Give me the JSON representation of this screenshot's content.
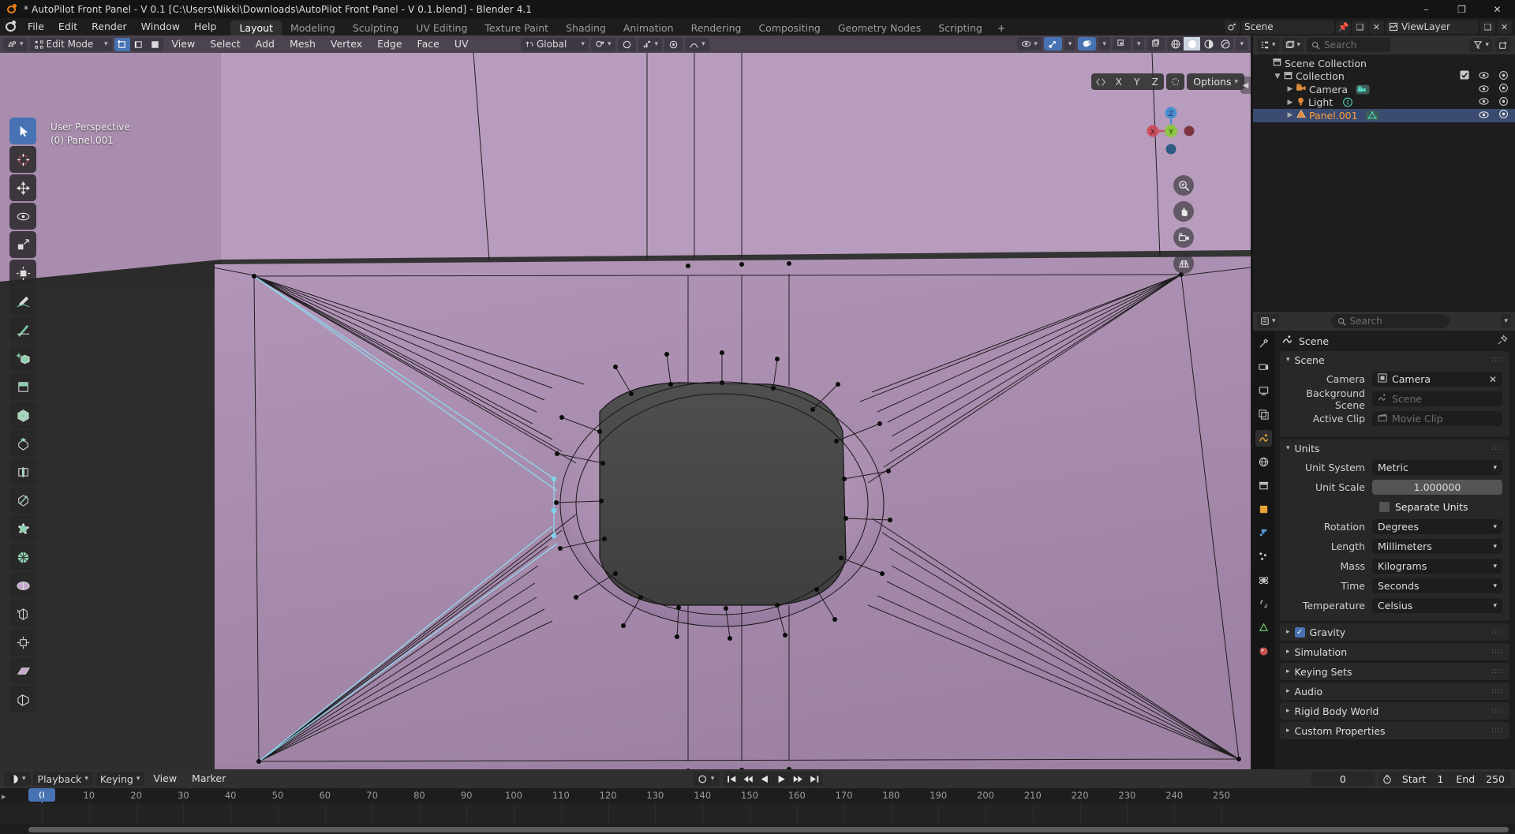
{
  "window": {
    "title": "* AutoPilot Front Panel - V 0.1 [C:\\Users\\Nikki\\Downloads\\AutoPilot Front Panel - V 0.1.blend] - Blender 4.1",
    "minimize": "–",
    "maximize": "❐",
    "close": "✕",
    "logo_icon": "blender-logo-icon"
  },
  "topbar": {
    "logo_icon": "blender-menu-icon",
    "menus": [
      "File",
      "Edit",
      "Render",
      "Window",
      "Help"
    ],
    "workspaces": [
      {
        "label": "Layout",
        "active": true
      },
      {
        "label": "Modeling",
        "active": false
      },
      {
        "label": "Sculpting",
        "active": false
      },
      {
        "label": "UV Editing",
        "active": false
      },
      {
        "label": "Texture Paint",
        "active": false
      },
      {
        "label": "Shading",
        "active": false
      },
      {
        "label": "Animation",
        "active": false
      },
      {
        "label": "Rendering",
        "active": false
      },
      {
        "label": "Compositing",
        "active": false
      },
      {
        "label": "Geometry Nodes",
        "active": false
      },
      {
        "label": "Scripting",
        "active": false
      }
    ],
    "add_workspace": "+",
    "scene_name": "Scene",
    "view_layer_name": "ViewLayer"
  },
  "viewport": {
    "mode": "Edit Mode",
    "mode_icon": "edit-mode-icon",
    "editor_type_icon": "editor-type-icon",
    "select_modes": [
      {
        "name": "vertex-select",
        "active": true
      },
      {
        "name": "edge-select",
        "active": false
      },
      {
        "name": "face-select",
        "active": false
      }
    ],
    "menus": [
      "View",
      "Select",
      "Add",
      "Mesh",
      "Vertex",
      "Edge",
      "Face",
      "UV"
    ],
    "transform_orientation": "Global",
    "snapping_icon": "magnet-icon",
    "proportional_icon": "proportional-edit-icon",
    "proportional_falloff_icon": "falloff-curve-icon",
    "shading_modes": [
      {
        "name": "wireframe-shading",
        "active": false
      },
      {
        "name": "solid-shading",
        "active": true
      },
      {
        "name": "material-preview-shading",
        "active": false
      },
      {
        "name": "rendered-shading",
        "active": false
      }
    ],
    "overlay_text_line1": "User Perspective",
    "overlay_text_line2": "(0) Panel.001",
    "options_label": "Options",
    "axis_buttons": [
      "X",
      "Y",
      "Z"
    ],
    "gizmo_axes": {
      "x": "X",
      "y": "Y",
      "z": "Z"
    },
    "tools": [
      {
        "name": "tweak-tool",
        "active": true
      },
      {
        "name": "cursor-tool",
        "active": false
      },
      {
        "name": "move-tool",
        "active": false
      },
      {
        "name": "rotate-tool",
        "active": false
      },
      {
        "name": "scale-tool",
        "active": false
      },
      {
        "name": "transform-tool",
        "active": false
      },
      {
        "name": "annotate-tool",
        "active": false
      },
      {
        "name": "measure-tool",
        "active": false
      },
      {
        "name": "add-cube-tool",
        "active": false
      },
      {
        "name": "extrude-region-tool",
        "active": false
      },
      {
        "name": "inset-faces-tool",
        "active": false
      },
      {
        "name": "bevel-tool",
        "active": false
      },
      {
        "name": "loop-cut-tool",
        "active": false
      },
      {
        "name": "knife-tool",
        "active": false
      },
      {
        "name": "poly-build-tool",
        "active": false
      },
      {
        "name": "spin-tool",
        "active": false
      },
      {
        "name": "smooth-tool",
        "active": false
      },
      {
        "name": "edge-slide-tool",
        "active": false
      },
      {
        "name": "shrink-fatten-tool",
        "active": false
      },
      {
        "name": "shear-tool",
        "active": false
      },
      {
        "name": "rip-region-tool",
        "active": false
      }
    ],
    "nav_buttons": [
      "zoom-icon",
      "pan-hand-icon",
      "camera-view-icon",
      "toggle-ortho-icon"
    ]
  },
  "outliner": {
    "display_mode_icon": "outliner-display-mode-icon",
    "filter_icon": "filter-icon",
    "new_collection_icon": "new-collection-icon",
    "search_placeholder": "Search",
    "rows": [
      {
        "indent": 0,
        "twisty": "",
        "icon": "scene-collection-icon",
        "name": "Scene Collection",
        "selected": false,
        "checkbox": false,
        "eye": false,
        "camera": false
      },
      {
        "indent": 1,
        "twisty": "▼",
        "icon": "collection-icon",
        "name": "Collection",
        "selected": false,
        "checkbox": true,
        "eye": true,
        "camera": true
      },
      {
        "indent": 2,
        "twisty": "▶",
        "icon": "camera-data-icon",
        "name": "Camera",
        "selected": false,
        "checkbox": false,
        "eye": true,
        "camera": true
      },
      {
        "indent": 2,
        "twisty": "▶",
        "icon": "light-data-icon",
        "name": "Light",
        "selected": false,
        "checkbox": false,
        "eye": true,
        "camera": true
      },
      {
        "indent": 2,
        "twisty": "▶",
        "icon": "mesh-data-icon",
        "name": "Panel.001",
        "selected": true,
        "checkbox": false,
        "eye": true,
        "camera": true
      }
    ]
  },
  "properties": {
    "search_placeholder": "Search",
    "breadcrumb": "Scene",
    "breadcrumb_icon": "scene-properties-icon",
    "pin_icon": "pin-icon",
    "tabs": [
      {
        "name": "tool-tab",
        "active": false
      },
      {
        "name": "render-properties-tab",
        "active": false
      },
      {
        "name": "output-properties-tab",
        "active": false
      },
      {
        "name": "view-layer-properties-tab",
        "active": false
      },
      {
        "name": "scene-properties-tab",
        "active": true
      },
      {
        "name": "world-properties-tab",
        "active": false
      },
      {
        "name": "collection-properties-tab",
        "active": false
      },
      {
        "name": "object-properties-tab",
        "active": false
      },
      {
        "name": "modifier-properties-tab",
        "active": false
      },
      {
        "name": "particle-properties-tab",
        "active": false
      },
      {
        "name": "physics-properties-tab",
        "active": false
      },
      {
        "name": "constraint-properties-tab",
        "active": false
      },
      {
        "name": "data-properties-tab",
        "active": false
      },
      {
        "name": "material-properties-tab",
        "active": false
      }
    ],
    "scene_panel": {
      "title": "Scene",
      "expanded": true,
      "rows": [
        {
          "label": "Camera",
          "value": "Camera",
          "icon": "camera-icon",
          "ghost": false,
          "clear": "✕"
        },
        {
          "label": "Background Scene",
          "value": "Scene",
          "icon": "scene-icon",
          "ghost": true,
          "clear": ""
        },
        {
          "label": "Active Clip",
          "value": "Movie Clip",
          "icon": "clip-icon",
          "ghost": true,
          "clear": ""
        }
      ]
    },
    "units_panel": {
      "title": "Units",
      "expanded": true,
      "unit_system_label": "Unit System",
      "unit_system_value": "Metric",
      "unit_scale_label": "Unit Scale",
      "unit_scale_value": "1.000000",
      "separate_units_label": "Separate Units",
      "separate_units_checked": false,
      "rows": [
        {
          "label": "Rotation",
          "value": "Degrees"
        },
        {
          "label": "Length",
          "value": "Millimeters"
        },
        {
          "label": "Mass",
          "value": "Kilograms"
        },
        {
          "label": "Time",
          "value": "Seconds"
        },
        {
          "label": "Temperature",
          "value": "Celsius"
        }
      ]
    },
    "collapsed_panels": [
      {
        "title": "Gravity",
        "checkbox": true,
        "checked": true
      },
      {
        "title": "Simulation",
        "checkbox": false,
        "checked": false
      },
      {
        "title": "Keying Sets",
        "checkbox": false,
        "checked": false
      },
      {
        "title": "Audio",
        "checkbox": false,
        "checked": false
      },
      {
        "title": "Rigid Body World",
        "checkbox": false,
        "checked": false
      },
      {
        "title": "Custom Properties",
        "checkbox": false,
        "checked": false
      }
    ]
  },
  "timeline": {
    "editor_icon": "timeline-editor-icon",
    "menus": [
      {
        "label": "Playback",
        "dropdown": true
      },
      {
        "label": "Keying",
        "dropdown": true
      },
      {
        "label": "View",
        "dropdown": false
      },
      {
        "label": "Marker",
        "dropdown": false
      }
    ],
    "auto_key_icon": "record-icon",
    "playback_buttons": [
      {
        "name": "jump-to-start-button",
        "glyph": "⏮"
      },
      {
        "name": "previous-keyframe-button",
        "glyph": "⏪"
      },
      {
        "name": "play-reverse-button",
        "glyph": "◀"
      },
      {
        "name": "play-button",
        "glyph": "▶"
      },
      {
        "name": "next-keyframe-button",
        "glyph": "⏩"
      },
      {
        "name": "jump-to-end-button",
        "glyph": "⏭"
      }
    ],
    "current_frame": "0",
    "start_label": "Start",
    "start_value": "1",
    "end_label": "End",
    "end_value": "250",
    "ticks": [
      "0",
      "10",
      "20",
      "30",
      "40",
      "50",
      "60",
      "70",
      "80",
      "90",
      "100",
      "110",
      "120",
      "130",
      "140",
      "150",
      "160",
      "170",
      "180",
      "190",
      "200",
      "210",
      "220",
      "230",
      "240",
      "250"
    ],
    "playhead_frame": 0
  },
  "colors": {
    "accent_blue": "#4772b3",
    "selected_orange": "#ff9c3f",
    "header_purple": "#4b4450",
    "mesh_purple": "#ae8fb3",
    "mesh_dark": "#4a4a4a"
  }
}
